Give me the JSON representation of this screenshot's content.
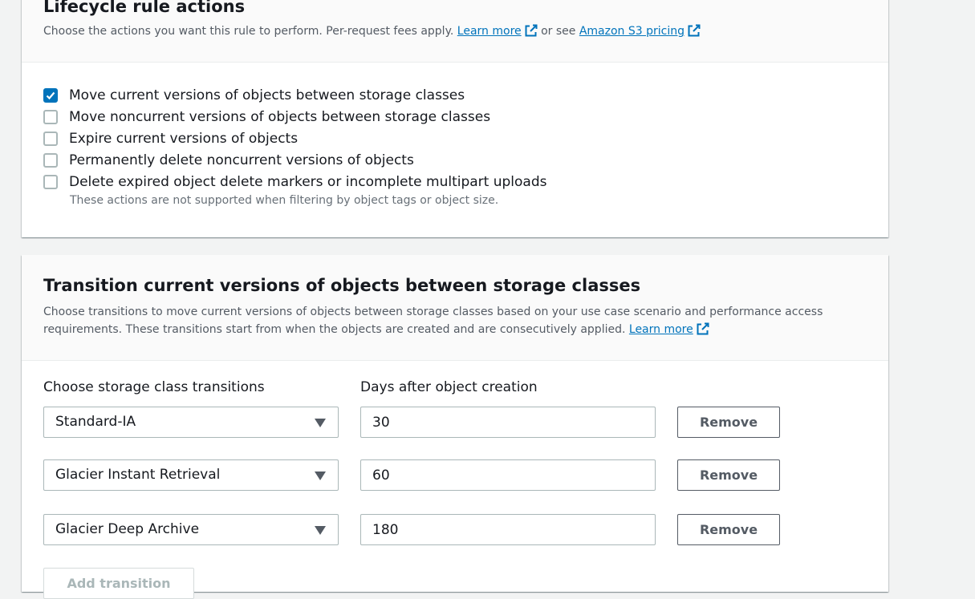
{
  "lifecycle": {
    "title": "Lifecycle rule actions",
    "description": "Choose the actions you want this rule to perform. Per-request fees apply.",
    "learn_more": "Learn more",
    "or_see": "or see",
    "pricing_link": "Amazon S3 pricing",
    "actions": [
      {
        "label": "Move current versions of objects between storage classes",
        "checked": true
      },
      {
        "label": "Move noncurrent versions of objects between storage classes",
        "checked": false
      },
      {
        "label": "Expire current versions of objects",
        "checked": false
      },
      {
        "label": "Permanently delete noncurrent versions of objects",
        "checked": false
      },
      {
        "label": "Delete expired object delete markers or incomplete multipart uploads",
        "checked": false
      }
    ],
    "hint": "These actions are not supported when filtering by object tags or object size."
  },
  "transition": {
    "title": "Transition current versions of objects between storage classes",
    "description": "Choose transitions to move current versions of objects between storage classes based on your use case scenario and performance access requirements. These transitions start from when the objects are created and are consecutively applied.",
    "learn_more": "Learn more",
    "storage_label": "Choose storage class transitions",
    "days_label": "Days after object creation",
    "rows": [
      {
        "storage_class": "Standard-IA",
        "days": "30",
        "remove": "Remove"
      },
      {
        "storage_class": "Glacier Instant Retrieval",
        "days": "60",
        "remove": "Remove"
      },
      {
        "storage_class": "Glacier Deep Archive",
        "days": "180",
        "remove": "Remove"
      }
    ],
    "add_button": "Add transition"
  },
  "colors": {
    "link": "#0073bb",
    "checkbox_checked": "#0073bb",
    "page_bg": "#f2f3f3"
  },
  "icons": [
    "external-link-icon",
    "checkmark-icon",
    "caret-down-icon"
  ]
}
